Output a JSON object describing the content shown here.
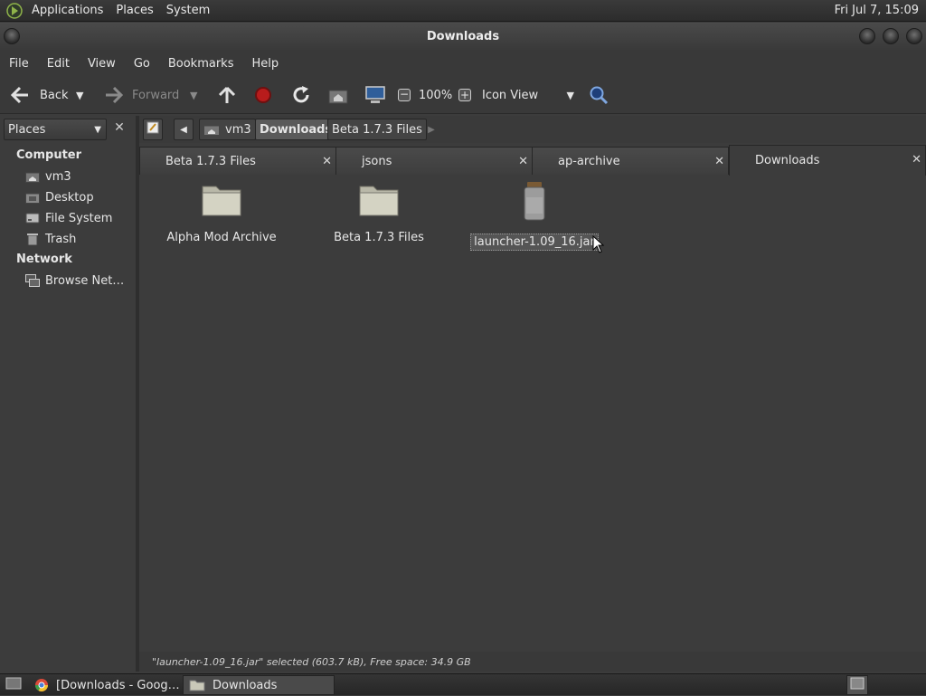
{
  "top_panel": {
    "menus": [
      "Applications",
      "Places",
      "System"
    ],
    "clock": "Fri Jul  7, 15:09",
    "icon": "gnome-foot-icon"
  },
  "window": {
    "title": "Downloads"
  },
  "menubar": [
    "File",
    "Edit",
    "View",
    "Go",
    "Bookmarks",
    "Help"
  ],
  "toolbar": {
    "back": "Back",
    "forward": "Forward",
    "zoom": "100%",
    "view_mode": "Icon View"
  },
  "sidebar": {
    "selector": "Places",
    "sections": {
      "computer": "Computer",
      "network": "Network"
    },
    "items": [
      {
        "label": "vm3",
        "icon": "home-folder-icon"
      },
      {
        "label": "Desktop",
        "icon": "desktop-folder-icon"
      },
      {
        "label": "File System",
        "icon": "drive-icon"
      },
      {
        "label": "Trash",
        "icon": "trash-icon"
      }
    ],
    "network_items": [
      {
        "label": "Browse Net…",
        "icon": "network-icon"
      }
    ]
  },
  "location": {
    "crumbs": [
      "vm3",
      "Downloads",
      "Beta 1.7.3 Files"
    ],
    "active": "Downloads"
  },
  "tabs": [
    {
      "label": "Beta 1.7.3 Files",
      "active": false
    },
    {
      "label": "jsons",
      "active": false
    },
    {
      "label": "ap-archive",
      "active": false
    },
    {
      "label": "Downloads",
      "active": true
    }
  ],
  "files": [
    {
      "name": "Alpha Mod Archive",
      "type": "folder",
      "selected": false
    },
    {
      "name": "Beta 1.7.3 Files",
      "type": "folder",
      "selected": false
    },
    {
      "name": "launcher-1.09_16.jar",
      "type": "jar",
      "selected": true
    }
  ],
  "status": "\"launcher-1.09_16.jar\" selected (603.7 kB), Free space: 34.9 GB",
  "taskbar": [
    {
      "label": "[Downloads - Goog…",
      "icon": "chrome-icon",
      "active": false
    },
    {
      "label": "Downloads",
      "icon": "folder-icon",
      "active": true
    }
  ],
  "colors": {
    "panel_bg": "#2c2c2c",
    "window_bg": "#3c3c3c",
    "text": "#e6e6e6"
  }
}
